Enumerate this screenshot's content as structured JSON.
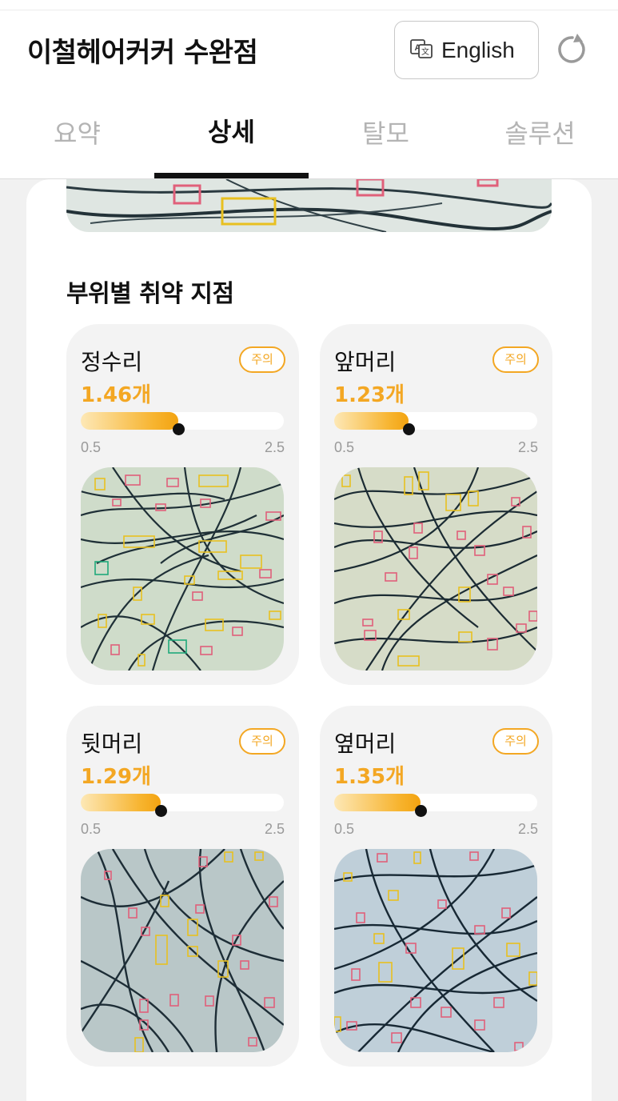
{
  "header": {
    "shop_title": "이철헤어커커 수완점",
    "language_button": "English"
  },
  "tabs": [
    {
      "label": "요약",
      "active": false
    },
    {
      "label": "상세",
      "active": true
    },
    {
      "label": "탈모",
      "active": false
    },
    {
      "label": "솔루션",
      "active": false
    }
  ],
  "section": {
    "title": "부위별 취약 지점"
  },
  "regions": [
    {
      "name": "정수리",
      "badge": "주의",
      "value_text": "1.46개",
      "value": 1.46,
      "min_label": "0.5",
      "max_label": "2.5",
      "min": 0.5,
      "max": 2.5
    },
    {
      "name": "앞머리",
      "badge": "주의",
      "value_text": "1.23개",
      "value": 1.23,
      "min_label": "0.5",
      "max_label": "2.5",
      "min": 0.5,
      "max": 2.5
    },
    {
      "name": "뒷머리",
      "badge": "주의",
      "value_text": "1.29개",
      "value": 1.29,
      "min_label": "0.5",
      "max_label": "2.5",
      "min": 0.5,
      "max": 2.5
    },
    {
      "name": "옆머리",
      "badge": "주의",
      "value_text": "1.35개",
      "value": 1.35,
      "min_label": "0.5",
      "max_label": "2.5",
      "min": 0.5,
      "max": 2.5
    }
  ],
  "colors": {
    "accent": "#f3a723",
    "active_tab": "#111111",
    "inactive_tab": "#b4b4b4",
    "box_red": "#e0607a",
    "box_yellow": "#e8c020",
    "box_green": "#1fa97a"
  },
  "icons": {
    "language": "translate-icon",
    "refresh": "refresh-icon"
  }
}
